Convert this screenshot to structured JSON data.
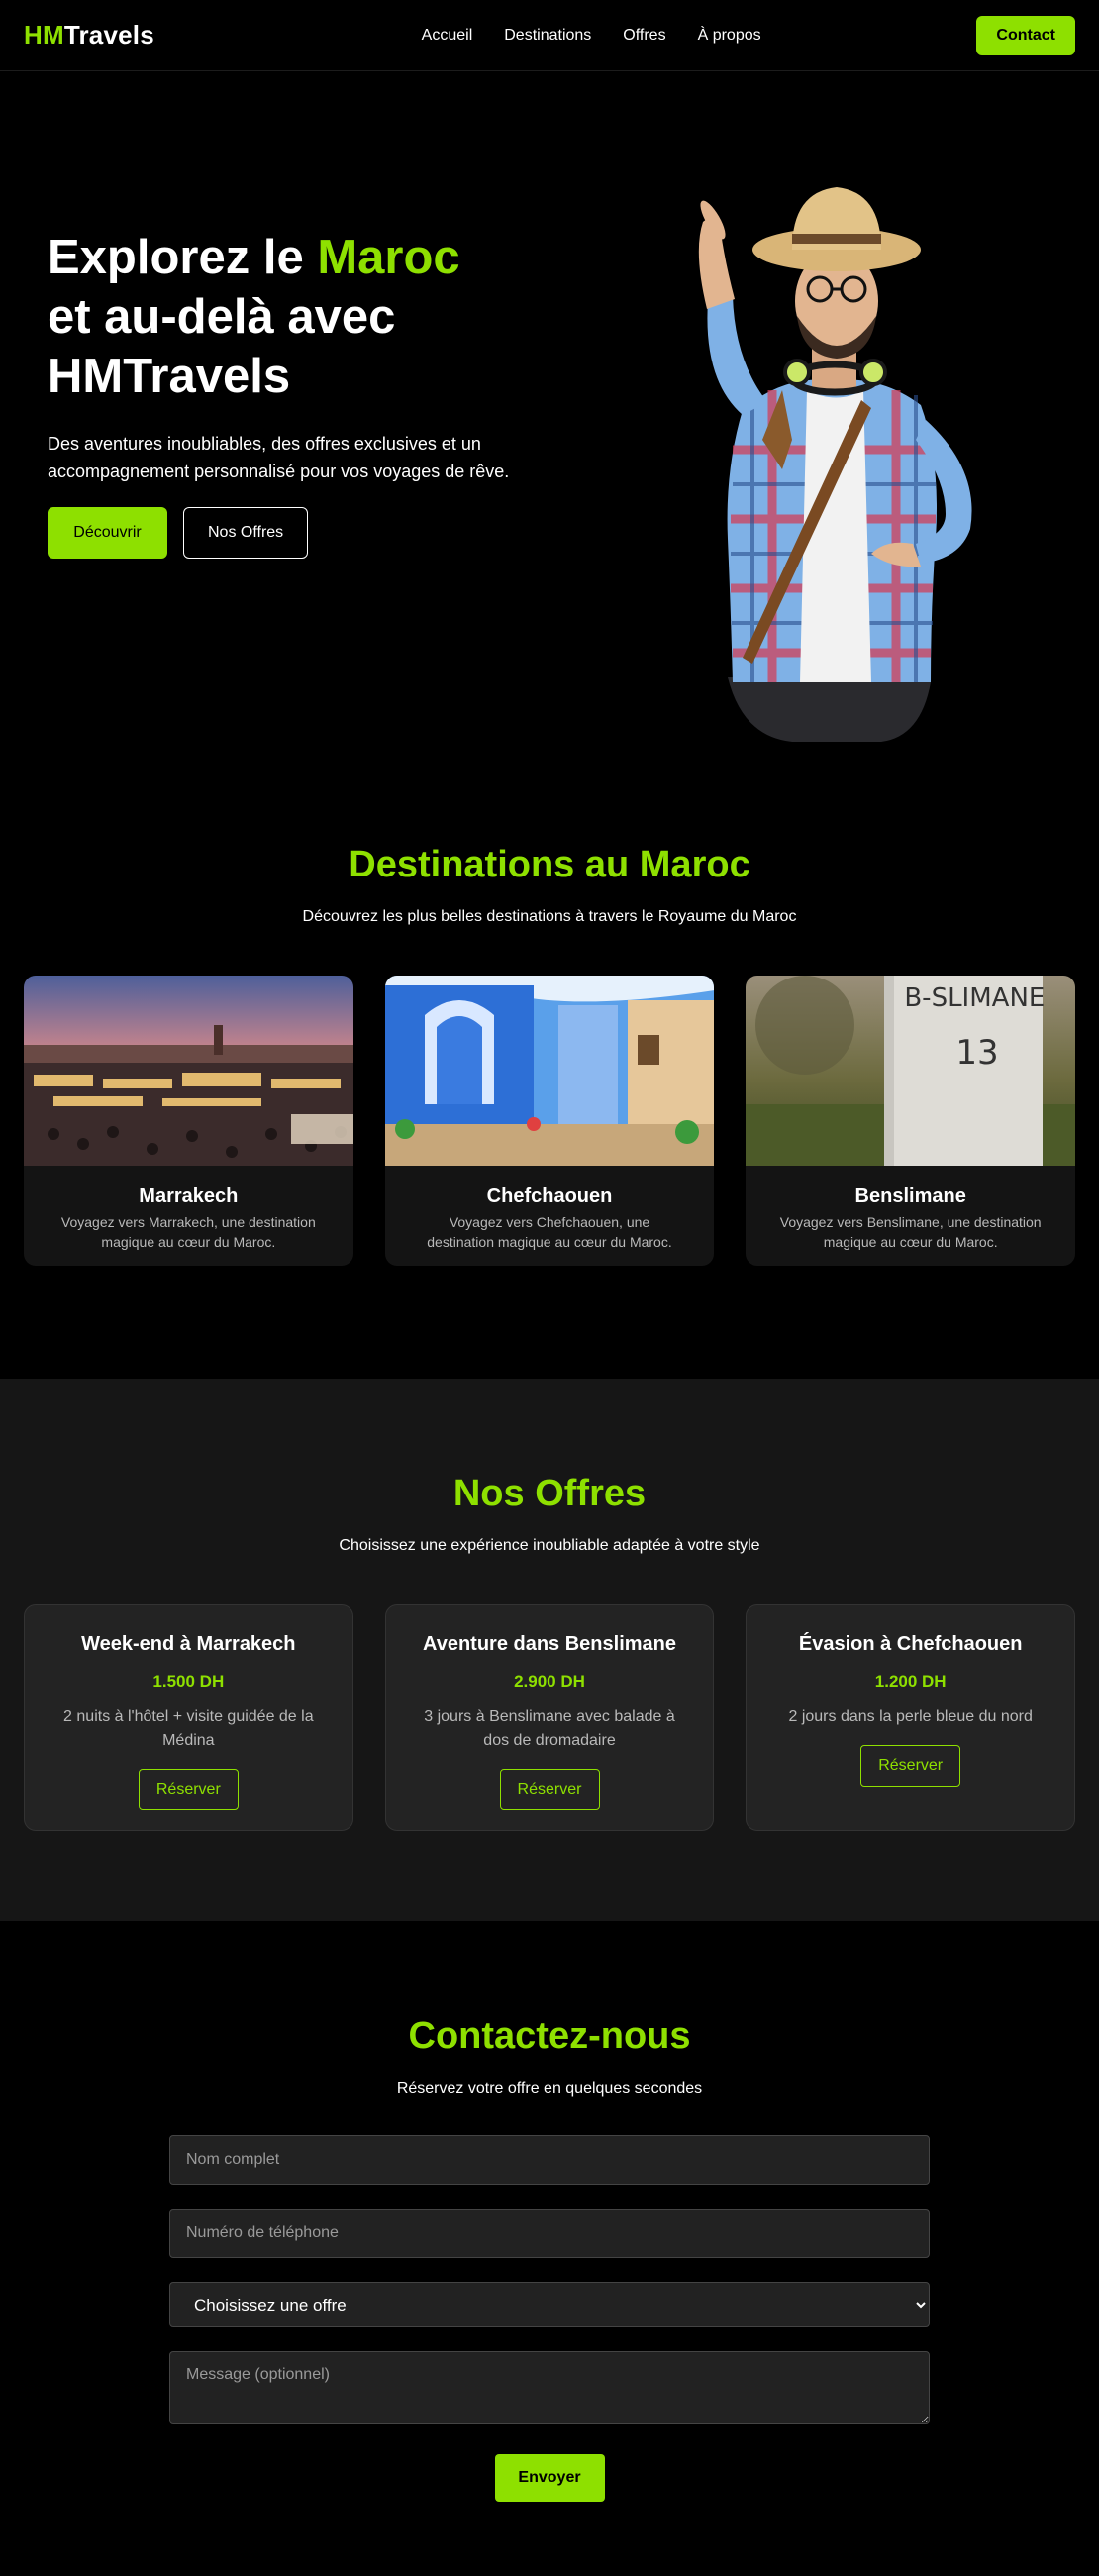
{
  "brand": {
    "prefix": "HM",
    "suffix": "Travels"
  },
  "nav": {
    "links": [
      "Accueil",
      "Destinations",
      "Offres",
      "À propos"
    ],
    "contact": "Contact"
  },
  "hero": {
    "title_part1": "Explorez le ",
    "title_accent": "Maroc",
    "title_line2": "et au-delà avec",
    "title_line3": "HMTravels",
    "description": "Des aventures inoubliables, des offres exclusives et un accompagnement personnalisé pour vos voyages de rêve.",
    "btn_primary": "Découvrir",
    "btn_secondary": "Nos Offres"
  },
  "destinations": {
    "title": "Destinations au Maroc",
    "subtitle": "Découvrez les plus belles destinations à travers le Royaume du Maroc",
    "items": [
      {
        "name": "Marrakech",
        "desc": "Voyagez vers Marrakech, une destination magique au cœur du Maroc."
      },
      {
        "name": "Chefchaouen",
        "desc": "Voyagez vers Chefchaouen, une destination magique au cœur du Maroc."
      },
      {
        "name": "Benslimane",
        "desc": "Voyagez vers Benslimane, une destination magique au cœur du Maroc."
      }
    ],
    "sign_text": "B-SLIMANE",
    "sign_number": "13"
  },
  "offers": {
    "title": "Nos Offres",
    "subtitle": "Choisissez une expérience inoubliable adaptée à votre style",
    "items": [
      {
        "title": "Week-end à Marrakech",
        "price": "1.500 DH",
        "desc": "2 nuits à l'hôtel + visite guidée de la Médina",
        "cta": "Réserver"
      },
      {
        "title": "Aventure dans Benslimane",
        "price": "2.900 DH",
        "desc": "3 jours à Benslimane avec balade à dos de dromadaire",
        "cta": "Réserver"
      },
      {
        "title": "Évasion à Chefchaouen",
        "price": "1.200 DH",
        "desc": "2 jours dans la perle bleue du nord",
        "cta": "Réserver"
      }
    ]
  },
  "contact": {
    "title": "Contactez-nous",
    "subtitle": "Réservez votre offre en quelques secondes",
    "name_placeholder": "Nom complet",
    "phone_placeholder": "Numéro de téléphone",
    "select_value": "Choisissez une offre",
    "message_placeholder": "Message (optionnel)",
    "submit": "Envoyer"
  },
  "colors": {
    "accent": "#8ee000",
    "background": "#000000",
    "card": "#141414",
    "offers_bg": "#161616"
  }
}
